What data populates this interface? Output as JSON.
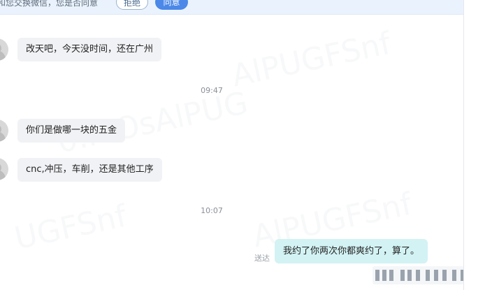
{
  "request_bar": {
    "text": "和您交换微信，您是否同意",
    "reject_label": "拒绝",
    "accept_label": "同意"
  },
  "messages": [
    {
      "side": "in",
      "text": "改天吧，今天没时间，还在广州"
    },
    {
      "side": "time",
      "text": "09:47"
    },
    {
      "side": "in",
      "text": "你们是做哪一块的五金"
    },
    {
      "side": "in",
      "text": "cnc,冲压，车削，还是其他工序"
    },
    {
      "side": "time",
      "text": "10:07"
    },
    {
      "side": "out",
      "text": "我约了你两次你都爽约了，算了。",
      "status": "送达"
    }
  ],
  "colors": {
    "accent": "#4b88e8",
    "incoming_bubble": "#f1f2f5",
    "outgoing_bubble": "#d3f2f4"
  }
}
